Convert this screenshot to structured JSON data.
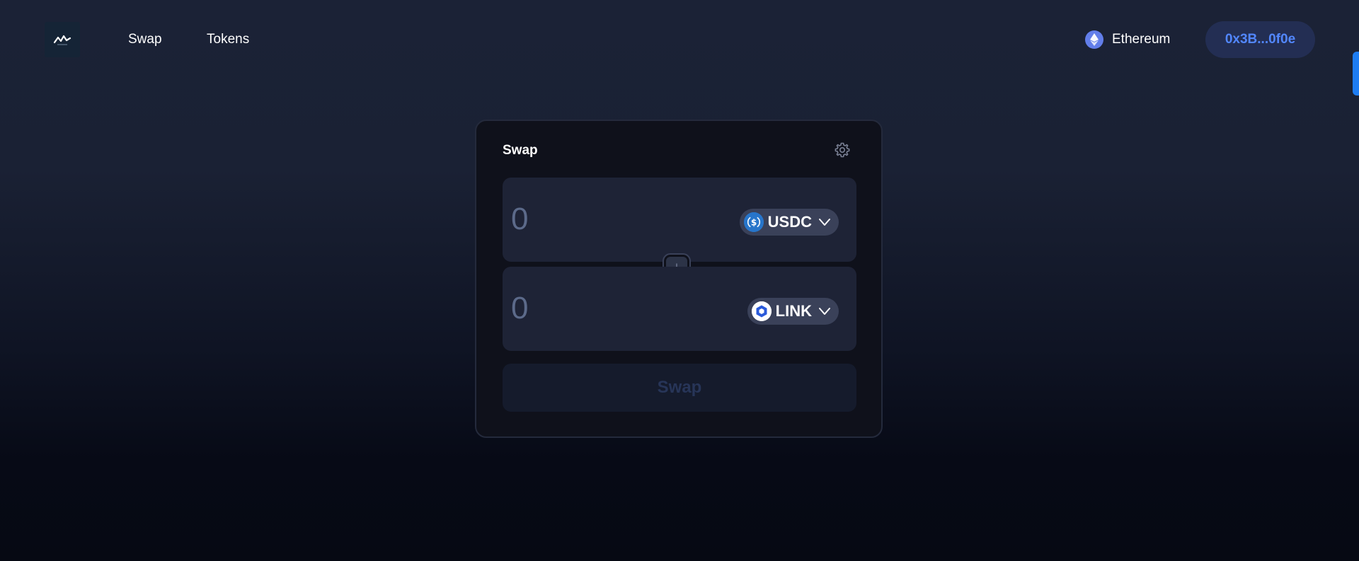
{
  "header": {
    "logo_icon": "dex-logo-icon",
    "nav": [
      {
        "label": "Swap"
      },
      {
        "label": "Tokens"
      }
    ],
    "network": {
      "label": "Ethereum",
      "icon": "ethereum-icon",
      "color": "#627eea"
    },
    "wallet": {
      "address": "0x3B...0f0e",
      "accent": "#5287ff"
    }
  },
  "swap_card": {
    "title": "Swap",
    "settings_icon": "gear-icon",
    "from": {
      "amount_placeholder": "0",
      "token": "USDC",
      "token_icon": "usdc-icon",
      "token_color": "#2775ca"
    },
    "switch_icon": "arrow-down-icon",
    "to": {
      "amount_placeholder": "0",
      "token": "LINK",
      "token_icon": "chainlink-icon",
      "token_color": "#2a5ada"
    },
    "submit_label": "Swap"
  }
}
